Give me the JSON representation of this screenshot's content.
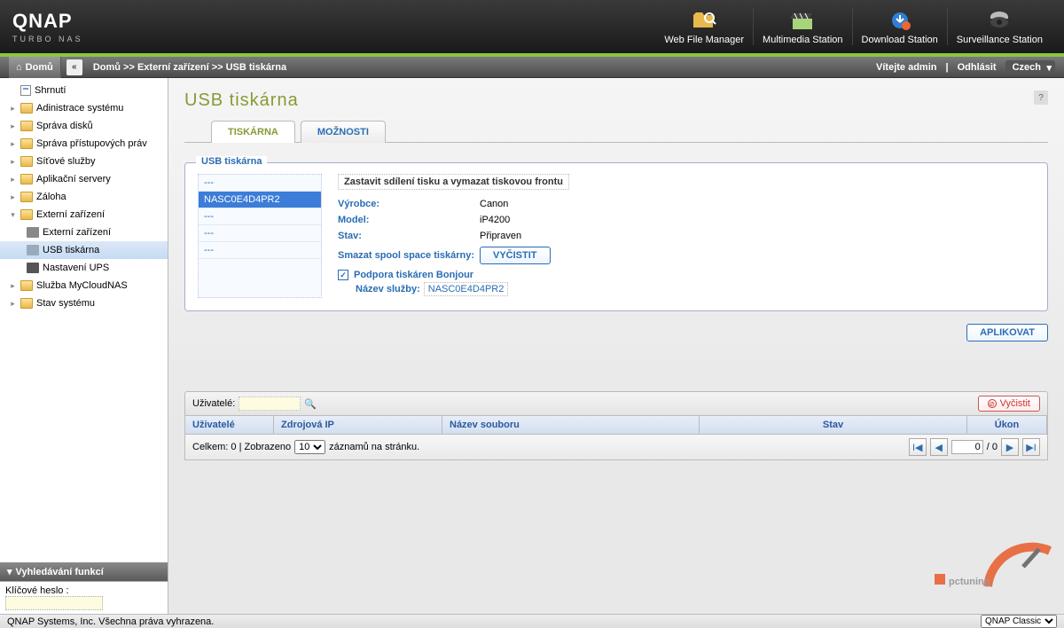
{
  "brand": "QNAP",
  "brand_sub": "TURBO NAS",
  "header_nav": {
    "wfm": "Web File Manager",
    "ms": "Multimedia Station",
    "ds": "Download Station",
    "ss": "Surveillance Station"
  },
  "crumbs": {
    "home": "Domů",
    "full": "Domů >> Externí zařízení >> USB tiskárna",
    "welcome": "Vítejte admin",
    "logout": "Odhlásit",
    "lang": "Czech"
  },
  "tree": {
    "n0": "Shrnutí",
    "n1": "Adinistrace systému",
    "n2": "Správa disků",
    "n3": "Správa přístupových práv",
    "n4": "Síťové služby",
    "n5": "Aplikační servery",
    "n6": "Záloha",
    "n7": "Externí zařízení",
    "n7a": "Externí zařízení",
    "n7b": "USB tiskárna",
    "n7c": "Nastavení UPS",
    "n8": "Služba MyCloudNAS",
    "n9": "Stav systému"
  },
  "search_panel": {
    "title": "Vyhledávání funkcí",
    "label": "Klíčové heslo :"
  },
  "page": {
    "title": "USB tiskárna",
    "tab_printer": "TISKÁRNA",
    "tab_options": "MOŽNOSTI"
  },
  "printer_box": {
    "legend": "USB tiskárna",
    "list": {
      "p0": "---",
      "p1": "NASC0E4D4PR2",
      "p2": "---",
      "p3": "---",
      "p4": "---"
    },
    "stop_action": "Zastavit sdílení tisku a vymazat tiskovou frontu",
    "man_label": "Výrobce:",
    "man_val": "Canon",
    "model_label": "Model:",
    "model_val": "iP4200",
    "state_label": "Stav:",
    "state_val": "Připraven",
    "spool_label": "Smazat spool space tiskárny:",
    "spool_btn": "VYČISTIT",
    "bonjour_label": "Podpora tiskáren Bonjour",
    "svc_label": "Název služby:",
    "svc_val": "NASC0E4D4PR2",
    "apply_btn": "APLIKOVAT"
  },
  "queue": {
    "users_label": "Uživatelé:",
    "clear_btn": "Vyčistit",
    "col_user": "Uživatelé",
    "col_ip": "Zdrojová IP",
    "col_file": "Název souboru",
    "col_state": "Stav",
    "col_action": "Úkon",
    "total_label": "Celkem:",
    "total_val": "0",
    "shown_label": "Zobrazeno",
    "per_page": "10",
    "per_page_suffix": "záznamů na stránku.",
    "page_cur": "0",
    "page_total": "/ 0"
  },
  "footer": {
    "copy": "QNAP Systems, Inc. Všechna práva vyhrazena.",
    "theme": "QNAP Classic"
  },
  "watermark": "pctuning"
}
